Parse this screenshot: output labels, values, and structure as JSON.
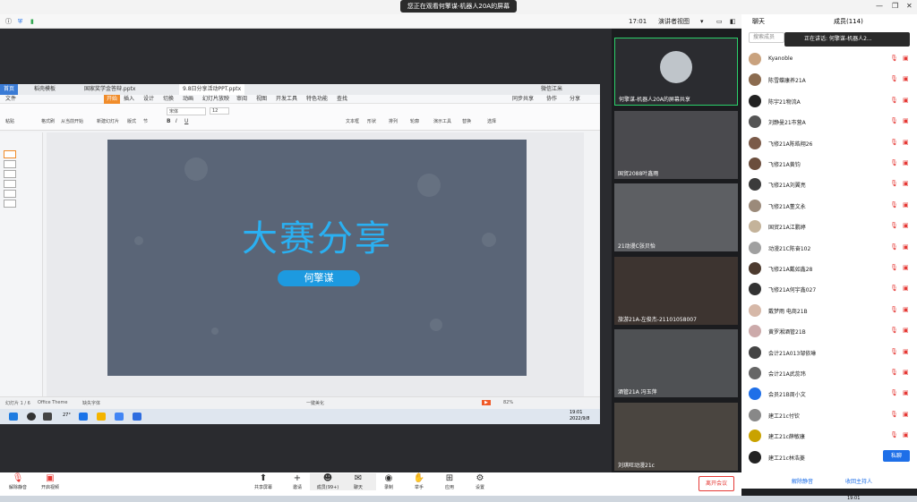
{
  "titlebar": {
    "watch_text": "您正在观看何擎谋-机器人20A的屏幕"
  },
  "toolbar": {
    "time": "17:01",
    "view_label": "演讲者视图",
    "chat_tab": "聊天",
    "members_tab": "成员(114)"
  },
  "wps": {
    "tabs": [
      "首页",
      "稻壳模板",
      "国家奖学金答辩.pptx",
      "9.8日分享活动PPT.pptx"
    ],
    "menu": [
      "文件",
      "开始",
      "插入",
      "设计",
      "切换",
      "动画",
      "幻灯片放映",
      "审阅",
      "视图",
      "开发工具",
      "特色功能",
      "查找"
    ],
    "right_menu": [
      "同步共享",
      "协作",
      "分享"
    ],
    "user": "微信江米",
    "font_name": "宋体",
    "font_size": "12",
    "ribbon": [
      "粘贴",
      "格式刷",
      "从当前开始",
      "新建幻灯片",
      "版式",
      "节",
      "文本框",
      "形状",
      "排列",
      "轮廓",
      "演示工具",
      "替换",
      "选择"
    ],
    "slide_title": "大赛分享",
    "slide_subtitle": "何擎谋",
    "status": {
      "slide_info": "幻灯片 1 / 6",
      "theme": "Office Theme",
      "font_missing": "缺失字体",
      "beautify": "一键美化",
      "zoom": "82%"
    },
    "taskbar_time": "19:01",
    "taskbar_date": "2022/9/8",
    "taskbar_temp": "27°"
  },
  "videos": [
    {
      "label": "何擎谋-机器人20A的屏幕共享"
    },
    {
      "label": "国贸2088叶鑫雨"
    },
    {
      "label": "21动漫C张贝怡"
    },
    {
      "label": "旅游21A-左俊杰-21101058007"
    },
    {
      "label": "酒管21A 冯玉萍"
    },
    {
      "label": "刘琪旺动漫21c"
    }
  ],
  "members": {
    "search_placeholder": "搜索成员",
    "speaking": "正在讲话: 何擎谋-机器人2...",
    "list": [
      "Kyanoble",
      "陈雪蝶康养21A",
      "陈宇21物流A",
      "刘静曼21市营A",
      "飞修21A陈皓翔26",
      "飞修21A黄钧",
      "飞修21A刘翼亮",
      "飞修21A董文永",
      "国贸21A江鹏婷",
      "动漫21C陈奋102",
      "飞修21A戴如鑫28",
      "飞修21A何宇鑫027",
      "戴梦雨 电商21B",
      "黄罗湘酒管21B",
      "会计21A013邹依琳",
      "会计21A武蕊玮",
      "会员21B周小文",
      "建工21c付钦",
      "建工21c薛敏康",
      "建工21c林浩菱"
    ],
    "private_btn": "私聊"
  },
  "chat_footer": {
    "mute_all": "解除静音",
    "take_host": "收回主持人"
  },
  "bottom": {
    "unmute": "解除静音",
    "video": "开启视频",
    "share": "共享屏幕",
    "invite": "邀请",
    "members": "成员(99+)",
    "chat": "聊天",
    "record": "录制",
    "hand": "举手",
    "apps": "应用",
    "settings": "设置",
    "leave": "离开会议",
    "os_time": "19:01"
  }
}
